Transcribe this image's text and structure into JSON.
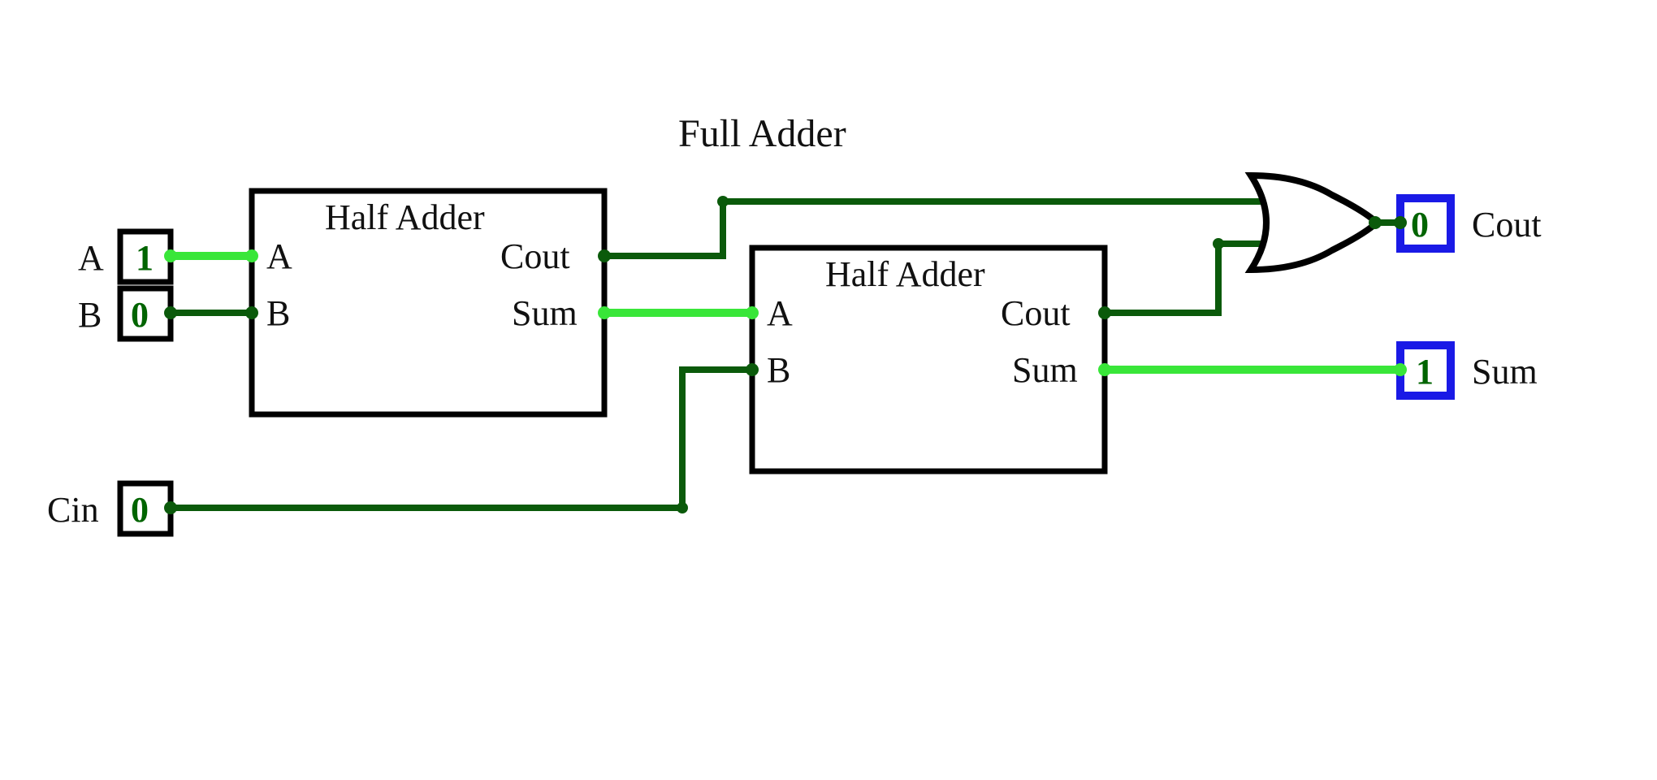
{
  "title": "Full Adder",
  "inputs": {
    "A": {
      "label": "A",
      "value": "1"
    },
    "B": {
      "label": "B",
      "value": "0"
    },
    "Cin": {
      "label": "Cin",
      "value": "0"
    }
  },
  "outputs": {
    "Cout": {
      "label": "Cout",
      "value": "0"
    },
    "Sum": {
      "label": "Sum",
      "value": "1"
    }
  },
  "half_adder1": {
    "title": "Half Adder",
    "ports": {
      "A": "A",
      "B": "B",
      "Cout": "Cout",
      "Sum": "Sum"
    }
  },
  "half_adder2": {
    "title": "Half Adder",
    "ports": {
      "A": "A",
      "B": "B",
      "Cout": "Cout",
      "Sum": "Sum"
    }
  },
  "colors": {
    "wire_low": "#0b5a0b",
    "wire_high": "#39e639",
    "output_box": "#1a1ae6",
    "input_box": "#000000"
  },
  "gate": {
    "type": "OR"
  }
}
